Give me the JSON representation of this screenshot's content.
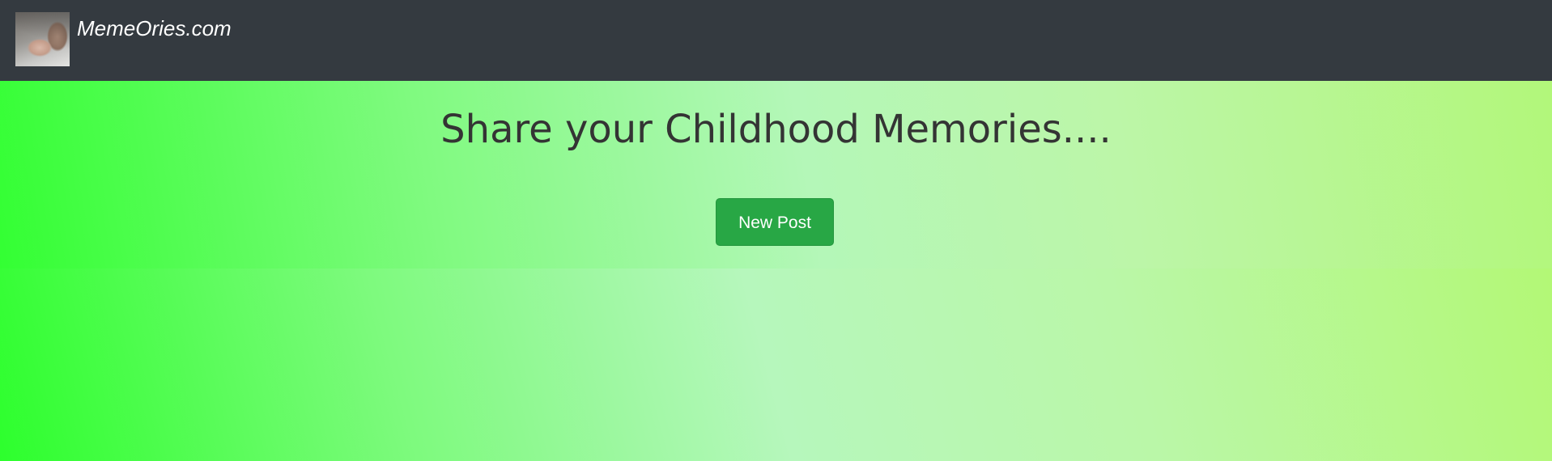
{
  "navbar": {
    "brand_name": "MemeOries.com",
    "background_color": "#343a40",
    "logo_icon": "baby-hand-photo-icon"
  },
  "hero": {
    "title": "Share your Childhood Memories....",
    "new_post_label": "New Post",
    "button_color": "#28a745"
  },
  "colors": {
    "gradient_green": "#2dff2d",
    "gradient_mint": "#b6f7bc",
    "gradient_lime": "#b2f870",
    "title_text": "#343434"
  }
}
